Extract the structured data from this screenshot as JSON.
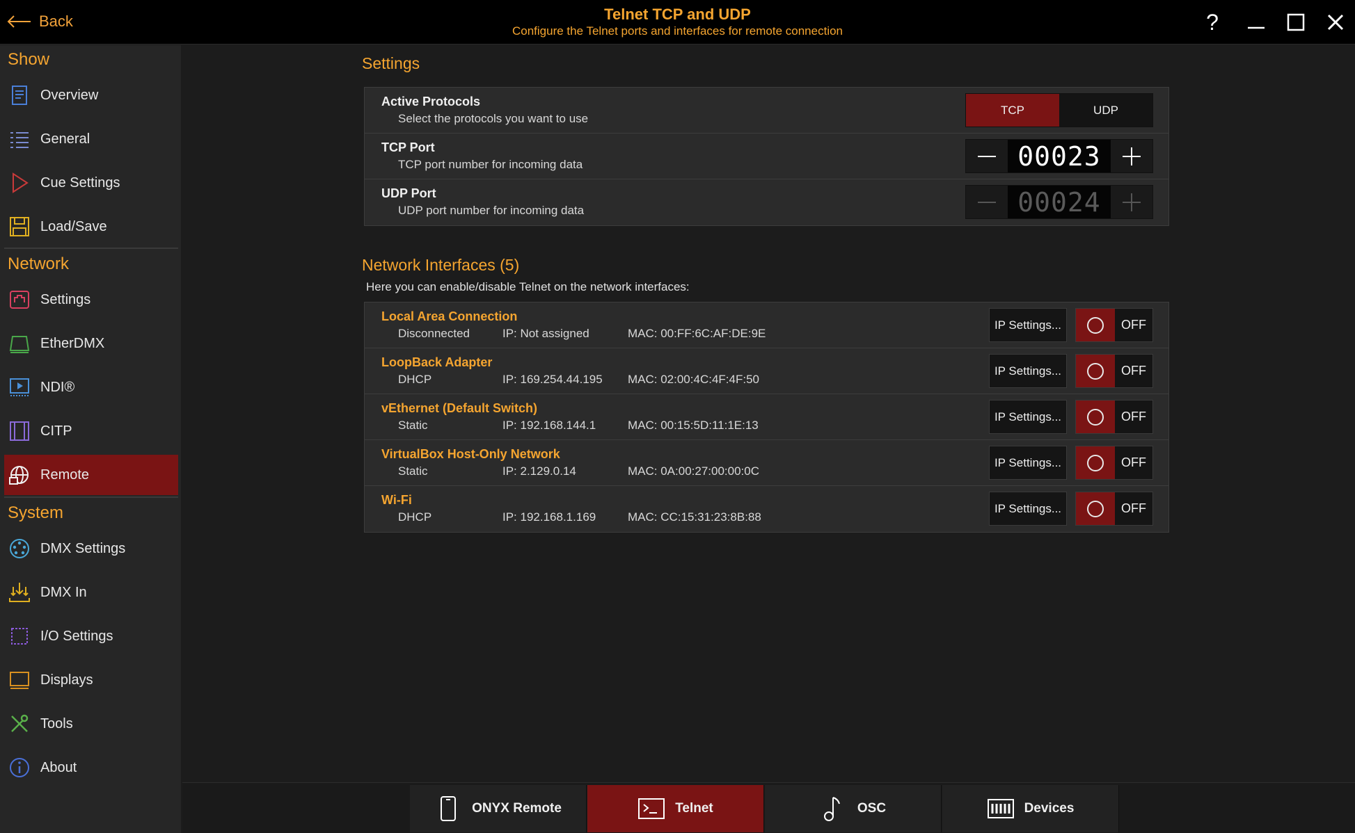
{
  "titlebar": {
    "back_label": "Back",
    "title": "Telnet TCP and UDP",
    "subtitle": "Configure the Telnet ports and interfaces for remote connection",
    "help_label": "?"
  },
  "sidebar": {
    "sections": [
      {
        "title": "Show"
      },
      {
        "title": "Network"
      },
      {
        "title": "System"
      }
    ],
    "items": [
      {
        "label": "Overview",
        "icon": "document-icon"
      },
      {
        "label": "General",
        "icon": "list-icon"
      },
      {
        "label": "Cue Settings",
        "icon": "play-triangle-icon"
      },
      {
        "label": "Load/Save",
        "icon": "floppy-disk-icon"
      },
      {
        "label": "Settings",
        "icon": "network-port-icon"
      },
      {
        "label": "EtherDMX",
        "icon": "ethernet-icon"
      },
      {
        "label": "NDI®",
        "icon": "ndi-icon"
      },
      {
        "label": "CITP",
        "icon": "film-icon"
      },
      {
        "label": "Remote",
        "icon": "globe-icon",
        "active": true
      },
      {
        "label": "DMX Settings",
        "icon": "dmx-connector-icon"
      },
      {
        "label": "DMX In",
        "icon": "dmx-in-icon"
      },
      {
        "label": "I/O Settings",
        "icon": "chip-icon"
      },
      {
        "label": "Displays",
        "icon": "display-icon"
      },
      {
        "label": "Tools",
        "icon": "tools-icon"
      },
      {
        "label": "About",
        "icon": "info-icon"
      }
    ]
  },
  "settings": {
    "heading": "Settings",
    "active_protocols": {
      "title": "Active Protocols",
      "subtitle": "Select the protocols you want to use",
      "options": [
        "TCP",
        "UDP"
      ],
      "selected": "TCP"
    },
    "tcp_port": {
      "title": "TCP Port",
      "subtitle": "TCP port number for incoming data",
      "value": "00023"
    },
    "udp_port": {
      "title": "UDP Port",
      "subtitle": "UDP port number for incoming data",
      "value": "00024",
      "enabled": false
    }
  },
  "network": {
    "heading": "Network Interfaces (5)",
    "note": "Here you can enable/disable Telnet on the network interfaces:",
    "ip_button_label": "IP Settings...",
    "toggle_label": "OFF",
    "interfaces": [
      {
        "name": "Local Area Connection",
        "mode": "Disconnected",
        "ip": "IP: Not assigned",
        "mac": "MAC: 00:FF:6C:AF:DE:9E"
      },
      {
        "name": "LoopBack Adapter",
        "mode": "DHCP",
        "ip": "IP: 169.254.44.195",
        "mac": "MAC: 02:00:4C:4F:4F:50"
      },
      {
        "name": "vEthernet (Default Switch)",
        "mode": "Static",
        "ip": "IP: 192.168.144.1",
        "mac": "MAC: 00:15:5D:11:1E:13"
      },
      {
        "name": "VirtualBox Host-Only Network",
        "mode": "Static",
        "ip": "IP: 2.129.0.14",
        "mac": "MAC: 0A:00:27:00:00:0C"
      },
      {
        "name": "Wi-Fi",
        "mode": "DHCP",
        "ip": "IP: 192.168.1.169",
        "mac": "MAC: CC:15:31:23:8B:88"
      }
    ]
  },
  "tabs": [
    {
      "label": "ONYX Remote",
      "icon": "phone-icon"
    },
    {
      "label": "Telnet",
      "icon": "terminal-icon",
      "active": true
    },
    {
      "label": "OSC",
      "icon": "music-note-icon"
    },
    {
      "label": "Devices",
      "icon": "keyboard-icon"
    }
  ],
  "colors": {
    "accent": "#f5a530",
    "active_red": "#7a1414",
    "background": "#1c1c1c"
  }
}
